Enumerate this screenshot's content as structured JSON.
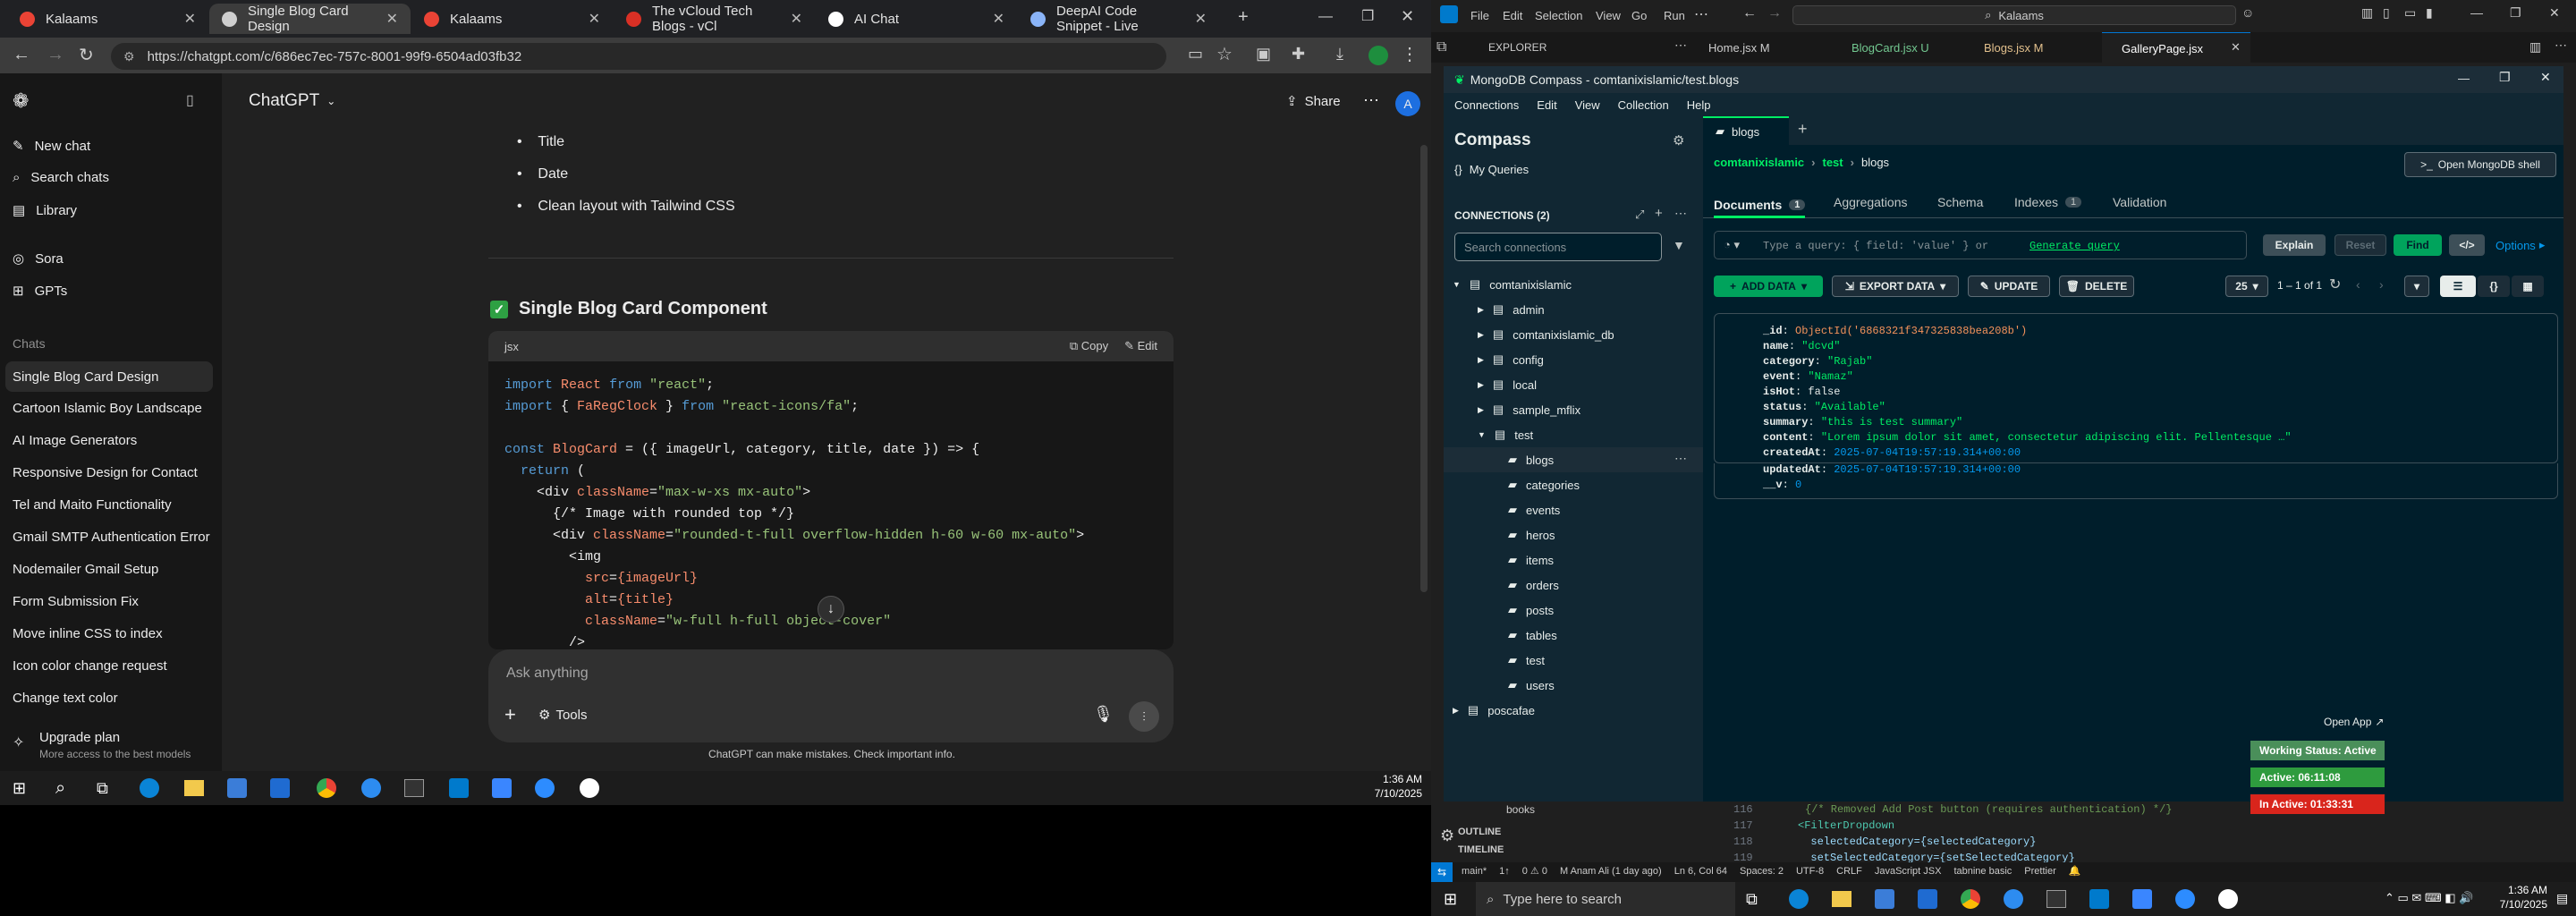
{
  "browser": {
    "tabs": [
      {
        "label": "Kalaams",
        "color": "#ea4335"
      },
      {
        "label": "Single Blog Card Design",
        "color": "#cfcfcf"
      },
      {
        "label": "Kalaams",
        "color": "#ea4335"
      },
      {
        "label": "The vCloud Tech Blogs - vCl",
        "color": "#d93025"
      },
      {
        "label": "AI Chat",
        "color": "#ffffff"
      },
      {
        "label": "DeepAI Code Snippet - Live",
        "color": "#8ab4f8"
      }
    ],
    "url": "https://chatgpt.com/c/686ec7ec-757c-8001-99f9-6504ad03fb32"
  },
  "chatgpt": {
    "title": "ChatGPT",
    "share_label": "Share",
    "avatar_letter": "A",
    "sidebar": {
      "nav": [
        "New chat",
        "Search chats",
        "Library",
        "Sora",
        "GPTs"
      ],
      "section_label": "Chats",
      "chats": [
        "Single Blog Card Design",
        "Cartoon Islamic Boy Landscape",
        "AI Image Generators",
        "Responsive Design for Contact",
        "Tel and Maito Functionality",
        "Gmail SMTP Authentication Error",
        "Nodemailer Gmail Setup",
        "Form Submission Fix",
        "Move inline CSS to index",
        "Icon color change request",
        "Change text color"
      ],
      "upgrade_title": "Upgrade plan",
      "upgrade_sub": "More access to the best models"
    },
    "bullets": [
      "Title",
      "Date",
      "Clean layout with Tailwind CSS"
    ],
    "heading": "Single Blog Card Component",
    "code": {
      "lang": "jsx",
      "copy_label": "Copy",
      "edit_label": "Edit",
      "lines": [
        "import React from \"react\";",
        "import { FaRegClock } from \"react-icons/fa\";",
        "",
        "const BlogCard = ({ imageUrl, category, title, date }) => {",
        "  return (",
        "    <div className=\"max-w-xs mx-auto\">",
        "      {/* Image with rounded top */}",
        "      <div className=\"rounded-t-full overflow-hidden h-60 w-60 mx-auto\">",
        "        <img",
        "          src={imageUrl}",
        "          alt={title}",
        "          className=\"w-full h-full object-cover\"",
        "        />"
      ]
    },
    "composer_placeholder": "Ask anything",
    "tools_label": "Tools",
    "disclaimer": "ChatGPT can make mistakes. Check important info."
  },
  "taskbar_left": {
    "time": "1:36 AM",
    "date": "7/10/2025"
  },
  "vscode": {
    "menu": [
      "File",
      "Edit",
      "Selection",
      "View",
      "Go",
      "Run"
    ],
    "search": "Kalaams",
    "explorer_label": "EXPLORER",
    "tabs": [
      "Home.jsx M",
      "BlogCard.jsx U",
      "Blogs.jsx M",
      "GalleryPage.jsx"
    ],
    "bottom_items": [
      "books",
      "OUTLINE",
      "TIMELINE"
    ],
    "line_numbers": [
      "116",
      "117",
      "118",
      "119"
    ],
    "code_lines": [
      "{/* Removed Add Post button (requires authentication) */}",
      "<FilterDropdown",
      "  selectedCategory={selectedCategory}",
      "  setSelectedCategory={setSelectedCategory}"
    ],
    "status": {
      "branch": "main*",
      "sync": "1↑",
      "problems": "0 ⚠ 0",
      "author": "M Anam Ali (1 day ago)",
      "position": "Ln 6, Col 64",
      "spaces": "Spaces: 2",
      "encoding": "UTF-8",
      "eol": "CRLF",
      "language": "JavaScript JSX",
      "tabnine": "tabnine basic",
      "prettier": "Prettier"
    }
  },
  "compass": {
    "window_title": "MongoDB Compass - comtanixislamic/test.blogs",
    "menu": [
      "Connections",
      "Edit",
      "View",
      "Collection",
      "Help"
    ],
    "app_name": "Compass",
    "my_queries": "My Queries",
    "connections_label": "CONNECTIONS (2)",
    "search_placeholder": "Search connections",
    "tree": {
      "connection": "comtanixislamic",
      "databases": [
        "admin",
        "comtanixislamic_db",
        "config",
        "local",
        "sample_mflix"
      ],
      "test_db": "test",
      "collections": [
        "blogs",
        "categories",
        "events",
        "heros",
        "items",
        "orders",
        "posts",
        "tables",
        "test",
        "users"
      ],
      "other_connection": "poscafae"
    },
    "tab_label": "blogs",
    "breadcrumb": [
      "comtanixislamic",
      "test",
      "blogs"
    ],
    "shell_button": "Open MongoDB shell",
    "subtabs": [
      {
        "label": "Documents",
        "count": "1"
      },
      {
        "label": "Aggregations",
        "count": ""
      },
      {
        "label": "Schema",
        "count": ""
      },
      {
        "label": "Indexes",
        "count": "1"
      },
      {
        "label": "Validation",
        "count": ""
      }
    ],
    "query_placeholder": "Type a query: { field: 'value' } or",
    "generate_query": "Generate query",
    "explain": "Explain",
    "reset": "Reset",
    "find": "Find",
    "options": "Options",
    "add_data": "ADD DATA",
    "export_data": "EXPORT DATA",
    "update": "UPDATE",
    "delete": "DELETE",
    "page_size": "25",
    "pagination": "1 – 1 of 1",
    "document": [
      {
        "key": "_id",
        "value": "ObjectId('6868321f347325838bea208b')",
        "color": "#f5935b"
      },
      {
        "key": "name",
        "value": "\"dcvd\"",
        "color": "#00ed64"
      },
      {
        "key": "category",
        "value": "\"Rajab\"",
        "color": "#00ed64"
      },
      {
        "key": "event",
        "value": "\"Namaz\"",
        "color": "#00ed64"
      },
      {
        "key": "isHot",
        "value": "false",
        "color": "#e8edeb"
      },
      {
        "key": "status",
        "value": "\"Available\"",
        "color": "#00ed64"
      },
      {
        "key": "summary",
        "value": "\"this is test summary\"",
        "color": "#00ed64"
      },
      {
        "key": "content",
        "value": "\"Lorem ipsum dolor sit amet, consectetur adipiscing elit. Pellentesque …\"",
        "color": "#00ed64"
      },
      {
        "key": "createdAt",
        "value": "2025-07-04T19:57:19.314+00:00",
        "color": "#0498ec"
      },
      {
        "key": "updatedAt",
        "value": "2025-07-04T19:57:19.314+00:00",
        "color": "#0498ec"
      },
      {
        "key": "__v",
        "value": "0",
        "color": "#0498ec"
      }
    ]
  },
  "widget": {
    "open_app": "Open App",
    "working_status": "Working Status: Active",
    "active": "Active: 06:11:08",
    "inactive": "In Active: 01:33:31"
  },
  "taskbar_right": {
    "search_placeholder": "Type here to search",
    "time": "1:36 AM",
    "date": "7/10/2025"
  }
}
